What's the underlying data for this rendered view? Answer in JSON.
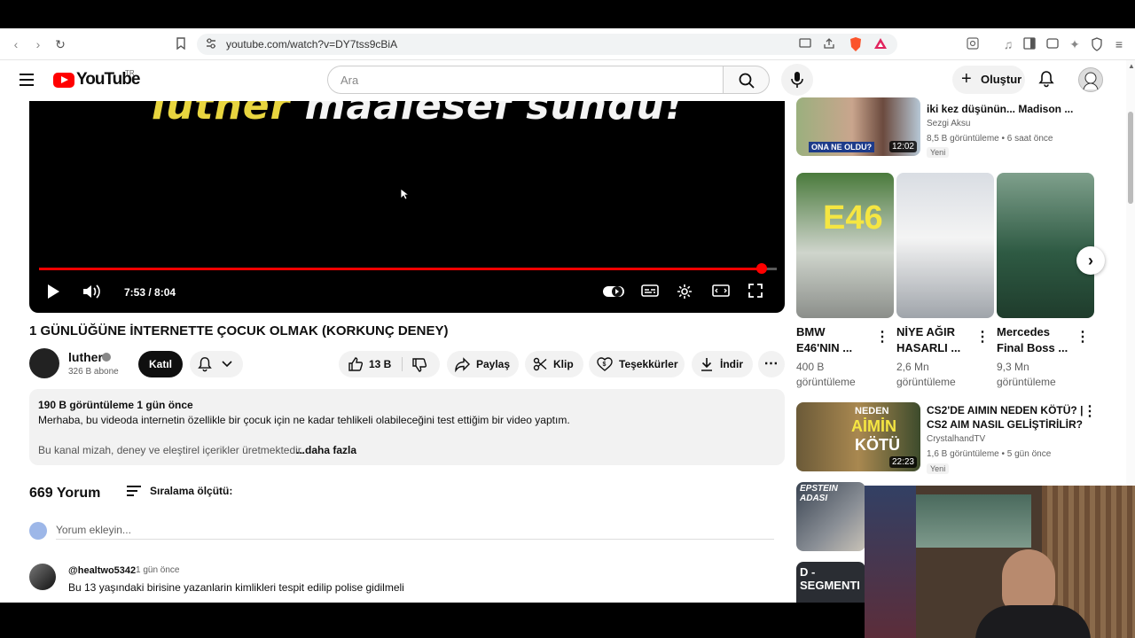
{
  "browser": {
    "url": "youtube.com/watch?v=DY7tss9cBiA",
    "icons": [
      "back-icon",
      "forward-icon",
      "reload-icon",
      "bookmark-icon",
      "site-settings-icon",
      "cast-icon",
      "share-icon",
      "brave-shield-icon",
      "brave-rewards-icon",
      "tab-search-icon",
      "media-icon",
      "sidebar-icon",
      "wallet-icon",
      "leo-icon",
      "vpn-icon",
      "menu-icon"
    ],
    "shield_badge": "57"
  },
  "header": {
    "logo": "YouTube",
    "country": "TR",
    "search_placeholder": "Ara",
    "create_label": "Oluştur"
  },
  "video": {
    "subtitle_a": "luther",
    "subtitle_b": "maalesef sundu!",
    "time": "7:53 / 8:04",
    "progress": 0.98,
    "title": "1 GÜNLÜĞÜNE İNTERNETTE ÇOCUK OLMAK (KORKUNÇ DENEY)"
  },
  "channel": {
    "name": "luther",
    "subs": "326 B abone",
    "join_label": "Katıl"
  },
  "actions": {
    "likes": "13 B",
    "share": "Paylaş",
    "clip": "Klip",
    "thanks": "Teşekkürler",
    "download": "İndir"
  },
  "description": {
    "meta": "190 B görüntüleme  1 gün önce",
    "line1": "Merhaba, bu videoda internetin özellikle bir çocuk için ne kadar tehlikeli olabileceğini test ettiğim bir video yaptım.",
    "line2": "Bu kanal mizah, deney ve eleştirel içerikler üretmektedir.",
    "more": "...daha fazla"
  },
  "comments": {
    "count": "669 Yorum",
    "sort_label": "Sıralama ölçütü:",
    "add_placeholder": "Yorum ekleyin...",
    "items": [
      {
        "user": "@healtwo5342",
        "time": "1 gün önce",
        "text": "Bu 13 yaşındaki birisine yazanlarin kimlikleri tespit edilip polise gidilmeli"
      }
    ]
  },
  "sidebar": {
    "top_video": {
      "title": "iki kez düşünün... Madison ...",
      "channel": "Sezgi Aksu",
      "meta": "8,5 B görüntüleme • 6 saat önce",
      "badge": "Yeni",
      "duration": "12:02",
      "thumb_text": "ONA NE OLDU?"
    },
    "shorts": [
      {
        "title_1": "BMW",
        "title_2": "E46'NIN ...",
        "views_1": "400 B",
        "views_2": "görüntüleme",
        "thumb_text": "E46"
      },
      {
        "title_1": "NİYE AĞIR",
        "title_2": "HASARLI ...",
        "views_1": "2,6 Mn",
        "views_2": "görüntüleme"
      },
      {
        "title_1": "Mercedes",
        "title_2": "Final Boss ...",
        "views_1": "9,3 Mn",
        "views_2": "görüntüleme"
      }
    ],
    "video2": {
      "title_1": "CS2'DE AIMIN NEDEN KÖTÜ? |",
      "title_2": "CS2 AIM NASIL GELİŞTİRİLİR?",
      "channel": "CrystalhandTV",
      "meta": "1,6 B görüntüleme • 5 gün önce",
      "badge": "Yeni",
      "duration": "22:23",
      "thumb_l1": "NEDEN",
      "thumb_l2": "AİMİN",
      "thumb_l3": "KÖTÜ"
    },
    "thumb3_text": "EPSTEIN ADASI",
    "thumb4_text": "D - SEGMENTI"
  }
}
